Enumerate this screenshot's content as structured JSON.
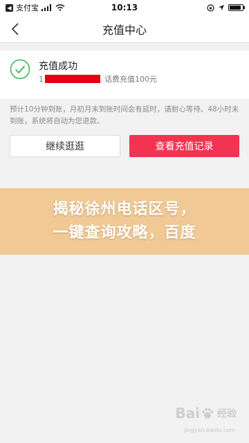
{
  "status_bar": {
    "back_icon": "back-arrow-icon",
    "app_name": "支付宝",
    "time": "10:13",
    "battery_level": 0.9
  },
  "nav": {
    "title": "充值中心",
    "back_icon": "chevron-left-icon"
  },
  "result": {
    "title": "充值成功",
    "phone_prefix": "1",
    "detail": "话费充值100元",
    "status_icon": "check-circle-icon"
  },
  "note": "预计10分钟到账，月初月末到账时间会有延时，请耐心等待。48小时未到账，系统将自动为您退款。",
  "buttons": {
    "continue_label": "继续逛逛",
    "records_label": "查看充值记录"
  },
  "banner": {
    "line1": "揭秘徐州电话区号，",
    "line2": "一键查询攻略，百度"
  },
  "watermark": {
    "logo": "Bai",
    "logo_suffix": "经验",
    "url": "jingyan.baidu.com"
  },
  "colors": {
    "accent": "#f23352",
    "success_green": "#35b558",
    "banner_bg": "#f0c995",
    "mask_red": "#e60012"
  }
}
